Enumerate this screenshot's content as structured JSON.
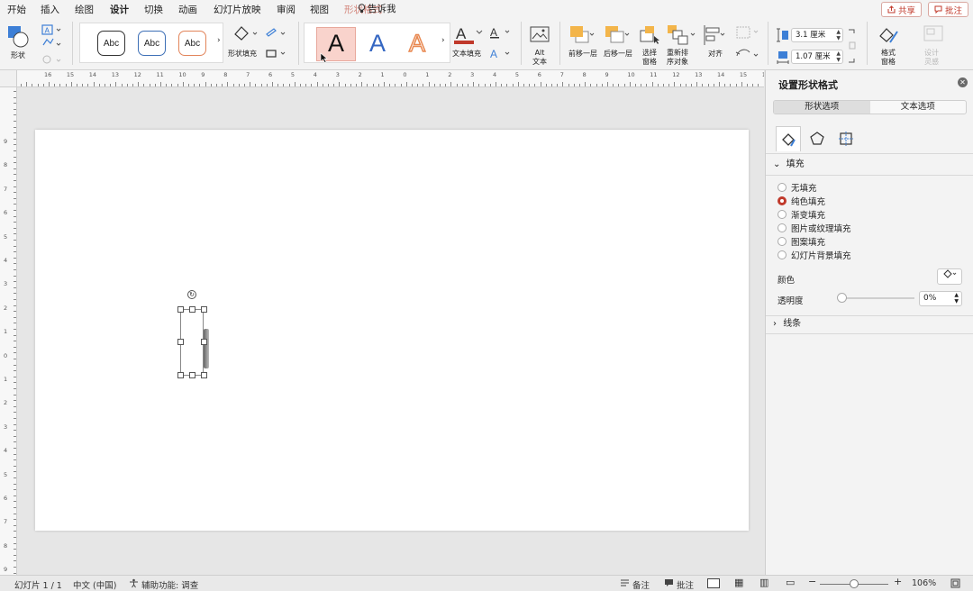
{
  "menu": {
    "tabs": [
      "开始",
      "插入",
      "绘图",
      "设计",
      "切换",
      "动画",
      "幻灯片放映",
      "审阅",
      "视图",
      "形状格式"
    ],
    "active_tab": "设计",
    "tell_me": "告诉我",
    "share": "共享",
    "comment": "批注"
  },
  "ribbon": {
    "shape_label": "形状",
    "style_samples": [
      "Abc",
      "Abc",
      "Abc"
    ],
    "shape_fill_label": "形状填充",
    "wordart_samples": [
      "A",
      "A",
      "A"
    ],
    "text_fill_label": "文本填充",
    "alt_text_label": "Alt\n文本",
    "bring_forward_label": "前移一层",
    "send_backward_label": "后移一层",
    "selection_pane_label": "选择\n窗格",
    "reorder_label": "重新排\n序对象",
    "align_label": "对齐",
    "height_value": "3.1 厘米",
    "width_value": "1.07 厘米",
    "format_pane_label": "格式\n窗格",
    "design_ideas_label": "设计\n灵感",
    "colors": {
      "accent": "#c0392b",
      "text_fill_bar": "#c0392b",
      "wordart_blue": "#3466c2",
      "wordart_orange": "#e8874f"
    }
  },
  "ruler": {
    "h_labels": [
      "16",
      "15",
      "14",
      "13",
      "12",
      "11",
      "10",
      "9",
      "8",
      "7",
      "6",
      "5",
      "4",
      "3",
      "2",
      "1",
      "0",
      "1",
      "2",
      "3",
      "4",
      "5",
      "6",
      "7",
      "8",
      "9",
      "10",
      "11",
      "12",
      "13",
      "14",
      "15",
      "16"
    ],
    "v_labels": [
      "9",
      "8",
      "7",
      "6",
      "5",
      "4",
      "3",
      "2",
      "1",
      "0",
      "1",
      "2",
      "3",
      "4",
      "5",
      "6",
      "7",
      "8",
      "9"
    ]
  },
  "pane": {
    "title": "设置形状格式",
    "tabs": [
      "形状选项",
      "文本选项"
    ],
    "active_tab": "形状选项",
    "fill_section": "填充",
    "fill_options": [
      "无填充",
      "纯色填充",
      "渐变填充",
      "图片或纹理填充",
      "图案填充",
      "幻灯片背景填充"
    ],
    "selected_fill": "纯色填充",
    "color_label": "颜色",
    "transparency_label": "透明度",
    "transparency_percent": 0,
    "transparency_value": "0%",
    "line_section": "线条"
  },
  "status": {
    "slide_info": "幻灯片 1 / 1",
    "language": "中文 (中国)",
    "accessibility": "辅助功能: 调查",
    "notes": "备注",
    "comments": "批注",
    "zoom_percent": 106,
    "zoom": "106%"
  }
}
